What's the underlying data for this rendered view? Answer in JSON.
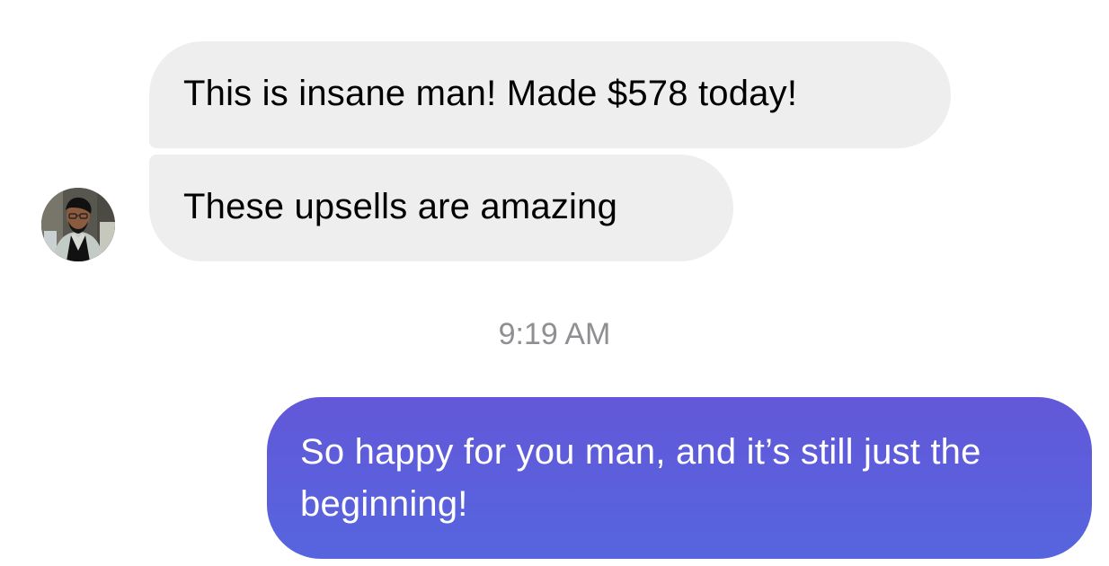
{
  "messages": [
    {
      "direction": "incoming",
      "text": "This is insane man! Made $578 today!"
    },
    {
      "direction": "incoming",
      "text": "These upsells are amazing"
    },
    {
      "direction": "outgoing",
      "text": "So happy for you man, and it’s still just the beginning!"
    }
  ],
  "timestamp": "9:19 AM",
  "colors": {
    "incoming_bubble": "#eeeeee",
    "outgoing_bubble": "#5c5fdc",
    "timestamp_text": "#8e8e93"
  },
  "icons": {
    "avatar": "user-avatar-icon"
  }
}
